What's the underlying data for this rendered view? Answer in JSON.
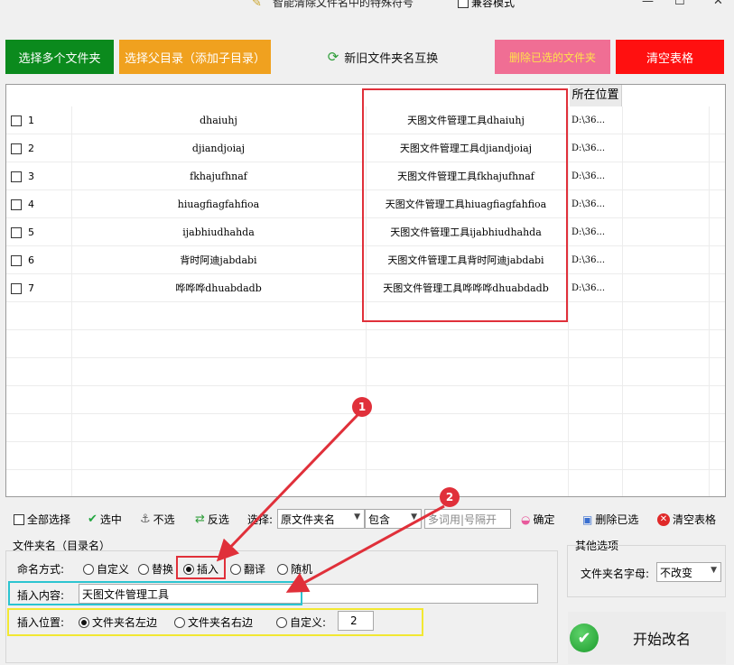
{
  "window": {
    "title": "智能清除文件名中的特殊符号",
    "compat_mode": "兼容模式",
    "min": "—",
    "max": "☐",
    "close": "✕"
  },
  "toolbar": {
    "select_folders": "选择多个文件夹",
    "select_parent": "选择父目录（添加子目录）",
    "swap_names": "新旧文件夹名互换",
    "delete_selected": "删除已选的文件夹",
    "clear_table": "清空表格"
  },
  "table": {
    "col_location": "所在位置",
    "rows": [
      {
        "idx": "1",
        "old": "dhaiuhj",
        "new": "天图文件管理工具dhaiuhj",
        "loc": "D:\\36..."
      },
      {
        "idx": "2",
        "old": "djiandjoiaj",
        "new": "天图文件管理工具djiandjoiaj",
        "loc": "D:\\36..."
      },
      {
        "idx": "3",
        "old": "fkhajufhnaf",
        "new": "天图文件管理工具fkhajufhnaf",
        "loc": "D:\\36..."
      },
      {
        "idx": "4",
        "old": "hiuagfiagfahfioa",
        "new": "天图文件管理工具hiuagfiagfahfioa",
        "loc": "D:\\36..."
      },
      {
        "idx": "5",
        "old": "ijabhiudhahda",
        "new": "天图文件管理工具ijabhiudhahda",
        "loc": "D:\\36..."
      },
      {
        "idx": "6",
        "old": "背时阿迪jabdabi",
        "new": "天图文件管理工具背时阿迪jabdabi",
        "loc": "D:\\36..."
      },
      {
        "idx": "7",
        "old": "哗哗哗dhuabdadb",
        "new": "天图文件管理工具哗哗哗dhuabdadb",
        "loc": "D:\\36..."
      }
    ]
  },
  "selection": {
    "select_all": "全部选择",
    "select": "选中",
    "deselect": "不选",
    "invert": "反选",
    "choose": "选择:",
    "field": "原文件夹名",
    "match": "包含",
    "keyword_placeholder": "多词用|号隔开",
    "confirm": "确定",
    "delete_selected": "删除已选",
    "clear_table": "清空表格"
  },
  "options": {
    "group_title": "文件夹名（目录名）",
    "naming_mode_label": "命名方式:",
    "modes": [
      "自定义",
      "替换",
      "插入",
      "翻译",
      "随机"
    ],
    "active_mode": "插入",
    "insert_content_label": "插入内容:",
    "insert_content_value": "天图文件管理工具",
    "insert_position_label": "插入位置:",
    "positions": [
      "文件夹名左边",
      "文件夹名右边",
      "自定义:"
    ],
    "active_position": "文件夹名左边",
    "custom_position_value": "2"
  },
  "other": {
    "group_title": "其他选项",
    "letter_case_label": "文件夹名字母:",
    "letter_case_value": "不改变"
  },
  "start": {
    "label": "开始改名"
  },
  "markers": {
    "one": "1",
    "two": "2"
  },
  "colors": {
    "green_btn": "#0b8a1d",
    "orange_btn": "#f0a11f",
    "pink_btn": "#f06e94",
    "red_btn": "#ff1010",
    "annotation_red": "#e0303a"
  }
}
